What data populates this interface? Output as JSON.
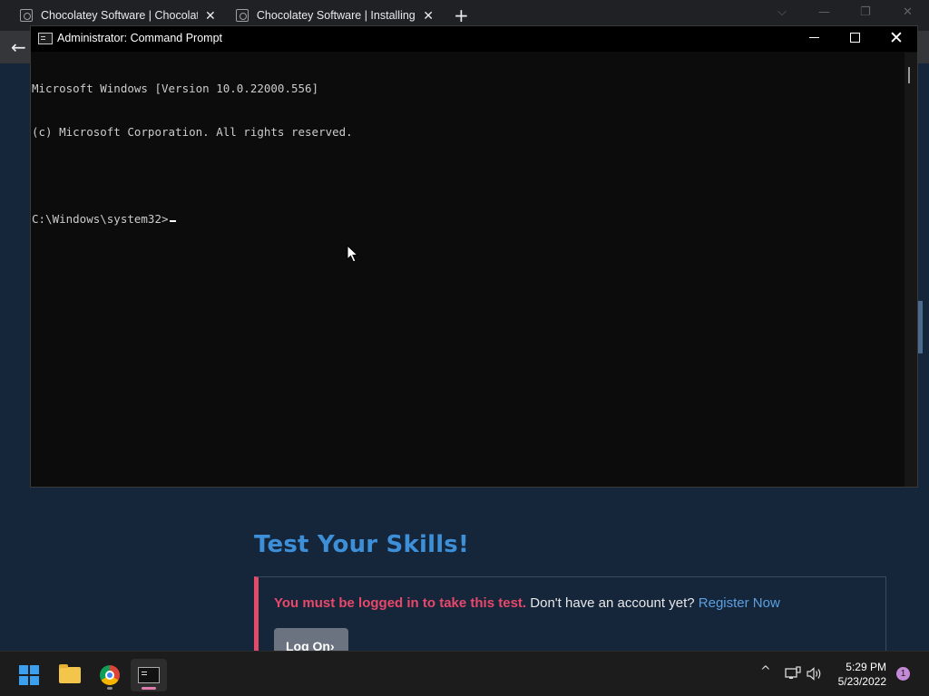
{
  "browser": {
    "tabs": [
      {
        "title": "Chocolatey Software | Chocolatey",
        "favicon": "chocolatey-favicon-icon"
      },
      {
        "title": "Chocolatey Software | Installing C",
        "favicon": "chocolatey-favicon-icon"
      }
    ],
    "new_tab_glyph": "+",
    "tab_close_glyph": "✕",
    "back_glyph": "←",
    "window_controls": [
      "⌵",
      "—",
      "❐",
      "✕"
    ]
  },
  "page": {
    "section_title": "Test Your Skills!",
    "alert": {
      "warning": "You must be logged in to take this test.",
      "prompt": "Don't have an account yet?",
      "link": "Register Now"
    },
    "logon_button": "Log On›",
    "accent_color": "#3d8fd8",
    "warning_color": "#e8486a"
  },
  "cmd": {
    "title": "Administrator: Command Prompt",
    "lines": [
      "Microsoft Windows [Version 10.0.22000.556]",
      "(c) Microsoft Corporation. All rights reserved.",
      "",
      "C:\\Windows\\system32>"
    ],
    "controls": {
      "minimize": "minimize-icon",
      "maximize": "maximize-icon",
      "close": "✕"
    }
  },
  "taskbar": {
    "apps": [
      "start-button",
      "file-explorer",
      "chrome",
      "command-prompt"
    ],
    "tray": {
      "chevron": "^",
      "time": "5:29 PM",
      "date": "5/23/2022",
      "notifications": "1"
    }
  }
}
